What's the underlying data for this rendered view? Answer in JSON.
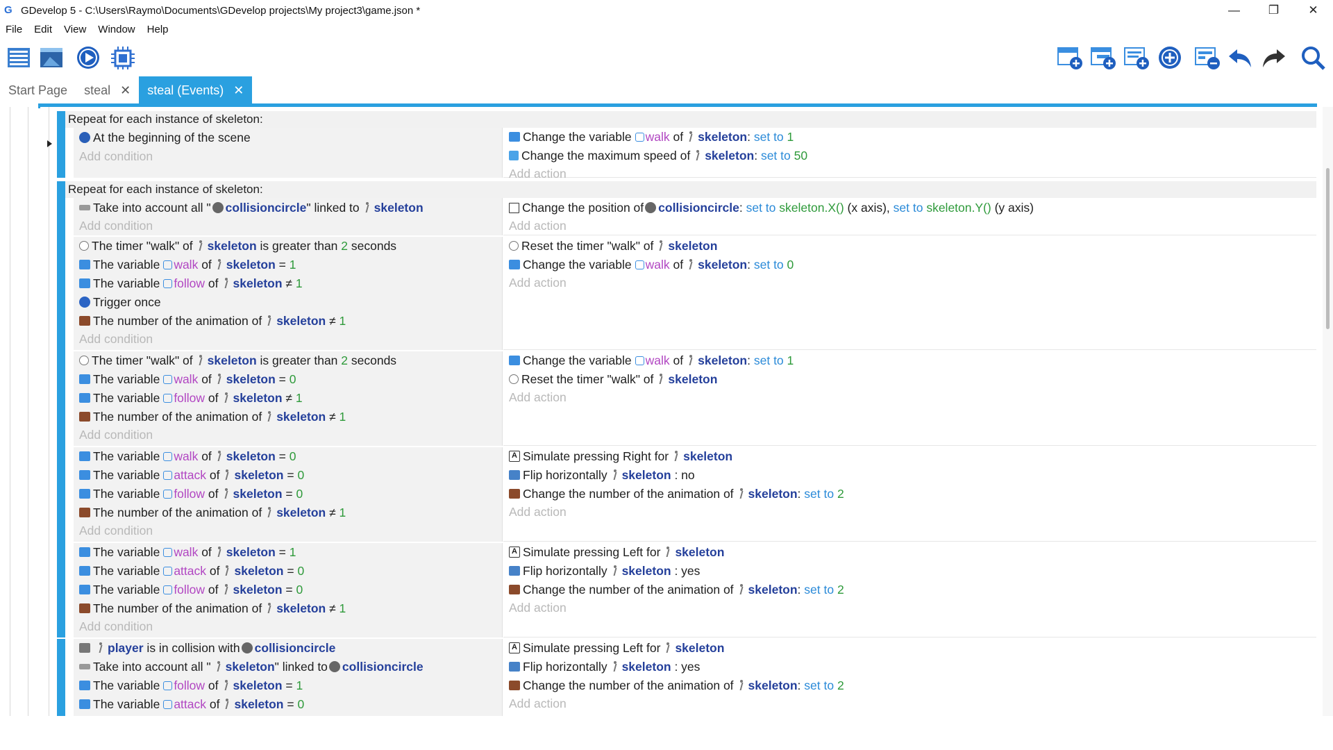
{
  "window": {
    "title": "GDevelop 5 - C:\\Users\\Raymo\\Documents\\GDevelop projects\\My project3\\game.json *",
    "controls": {
      "minimize": "—",
      "restore": "❐",
      "close": "✕"
    }
  },
  "menu": [
    "File",
    "Edit",
    "View",
    "Window",
    "Help"
  ],
  "toolbar": {
    "left_icons": [
      "project-manager-icon",
      "scene-editor-icon",
      "preview-icon",
      "debugger-icon"
    ],
    "right_icons": [
      "add-event-icon",
      "add-subevent-icon",
      "add-comment-icon",
      "add-other-icon",
      "delete-event-icon",
      "undo-icon",
      "redo-icon",
      "search-icon"
    ]
  },
  "tabs": [
    {
      "label": "Start Page",
      "closable": false,
      "active": false
    },
    {
      "label": "steal",
      "closable": true,
      "active": false
    },
    {
      "label": "steal (Events)",
      "closable": true,
      "active": true
    }
  ],
  "text": {
    "add_condition": "Add condition",
    "add_action": "Add action",
    "repeat_header": "Repeat for each instance of skeleton:",
    "skeleton": "skeleton",
    "collisioncircle": "collisioncircle",
    "player": "player"
  },
  "colors": {
    "accent": "#2aa0e0",
    "object": "#25409b",
    "variable": "#b146c2",
    "keyword": "#2a8ad8",
    "number": "#2e9a3a"
  }
}
